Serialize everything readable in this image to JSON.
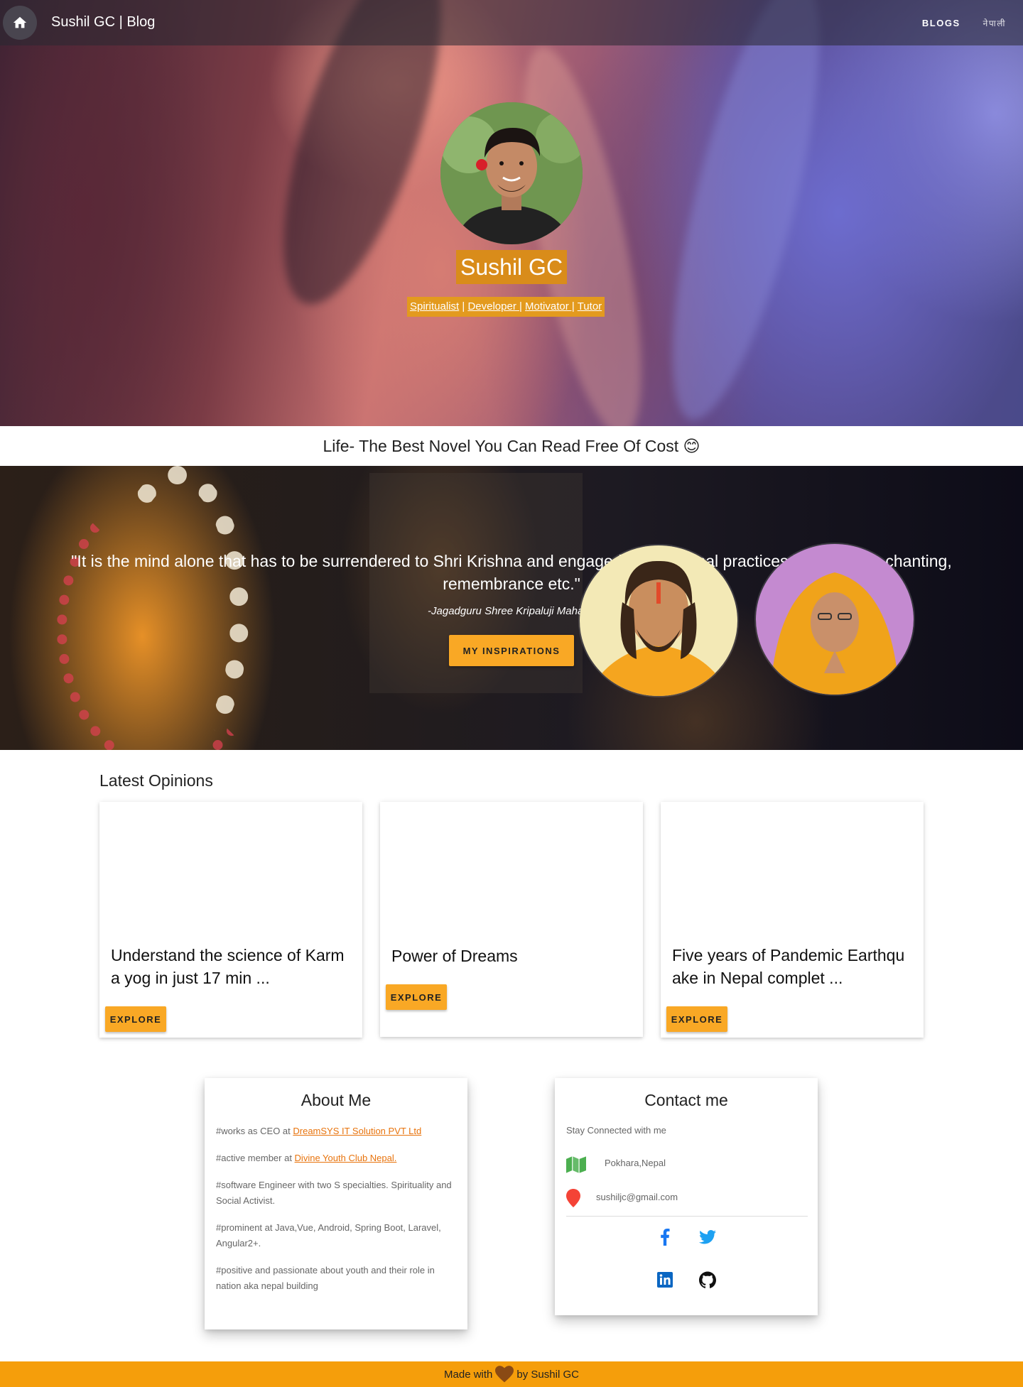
{
  "nav": {
    "brand": "Sushil GC | Blog",
    "links": [
      {
        "label": "BLOGS"
      },
      {
        "label": "नेपाली"
      }
    ]
  },
  "hero": {
    "name": "Sushil GC",
    "roles": [
      {
        "label": "Spiritualist",
        "sep": " | "
      },
      {
        "label": "Developer |",
        "sep": " "
      },
      {
        "label": "Motivator |",
        "sep": " "
      },
      {
        "label": "Tutor",
        "sep": ""
      }
    ]
  },
  "tagline": "Life- The Best Novel You Can Read Free Of Cost 😊",
  "quote": {
    "text": "\"It is the mind alone that has to be surrendered to Shri Krishna and engaged in devotional practices like hearing, chanting, remembrance etc.\"",
    "author": "-Jagadguru Shree Kripaluji Maharaj",
    "button_label": "MY INSPIRATIONS"
  },
  "opinions": {
    "title": "Latest Opinions",
    "cards": [
      {
        "title": "Understand the science of Karma yog in just 17 min ...",
        "button_label": "EXPLORE"
      },
      {
        "title": "Power of Dreams",
        "button_label": "EXPLORE"
      },
      {
        "title": "Five years of Pandemic Earthquake in Nepal complet ...",
        "button_label": "EXPLORE"
      }
    ]
  },
  "about": {
    "title": "About Me",
    "line1_prefix": "#works as CEO at ",
    "line1_link": "DreamSYS IT Solution PVT Ltd",
    "line2_prefix": "#active member at ",
    "line2_link": "Divine Youth Club Nepal.",
    "line3": "#software Engineer with two S specialties. Spirituality and Social Activist.",
    "line4": "#prominent at Java,Vue, Android, Spring Boot, Laravel, Angular2+.",
    "line5": "#positive and passionate about youth and their role in nation aka nepal building"
  },
  "contact": {
    "title": "Contact me",
    "subtitle": "Stay Connected with me",
    "location": "Pokhara,Nepal",
    "email": "sushiljc@gmail.com",
    "social": [
      "facebook-icon",
      "twitter-icon",
      "linkedin-icon",
      "github-icon"
    ]
  },
  "footer": {
    "prefix": "Made with",
    "suffix": "by Sushil GC"
  },
  "colors": {
    "accent": "#f9a825",
    "footer": "#f59e0b",
    "link": "#e8730c",
    "name_bg": "#d98c1a"
  }
}
